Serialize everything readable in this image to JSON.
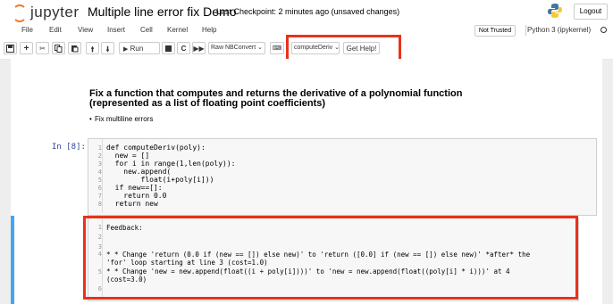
{
  "header": {
    "logo_text": "jupyter",
    "notebook_title": "Multiple line error fix Demo",
    "checkpoint": "Last Checkpoint: 2 minutes ago  (unsaved changes)",
    "logout_label": "Logout"
  },
  "menubar": {
    "items": [
      "File",
      "Edit",
      "View",
      "Insert",
      "Cell",
      "Kernel",
      "Help"
    ],
    "trust_status": "Not Trusted",
    "kernel_name": "Python 3 (ipykernel)"
  },
  "toolbar": {
    "run_label": "Run",
    "cell_type": "Raw NBConvert",
    "function_select": "computeDeriv",
    "get_help_label": "Get Help!"
  },
  "markdown": {
    "heading_line1": "Fix a function that computes and returns the derivative of a polynomial function",
    "heading_line2": "(represented as a list of floating point coefficients)",
    "bullet": "Fix multiline errors"
  },
  "code_cell": {
    "prompt": "In [8]:",
    "lines": [
      "def computeDeriv(poly):",
      "  new = []",
      "  for i in range(1,len(poly)):",
      "    new.append(",
      "        float(i+poly[i]))",
      "  if new==[]:",
      "    return 0.0",
      "  return new"
    ]
  },
  "feedback_cell": {
    "line_numbers": [
      "1",
      "2",
      "3",
      "4",
      "5",
      "6"
    ],
    "line1": "Feedback:",
    "line4a": "* * Change 'return (0.0 if (new == []) else new)' to 'return ([0.0] if (new == []) else new)' *after* the",
    "line4b": "'for' loop starting at line 3 (cost=1.0)",
    "line5a": "* * Change 'new = new.append(float((i + poly[i])))' to 'new = new.append(float((poly[i] * i)))' at 4",
    "line5b": "(cost=3.0)"
  },
  "colors": {
    "accent_orange": "#f37726",
    "highlight_red": "#e8321c",
    "selected_cell_border": "#42a5f5",
    "prompt_blue": "#303f9f"
  }
}
